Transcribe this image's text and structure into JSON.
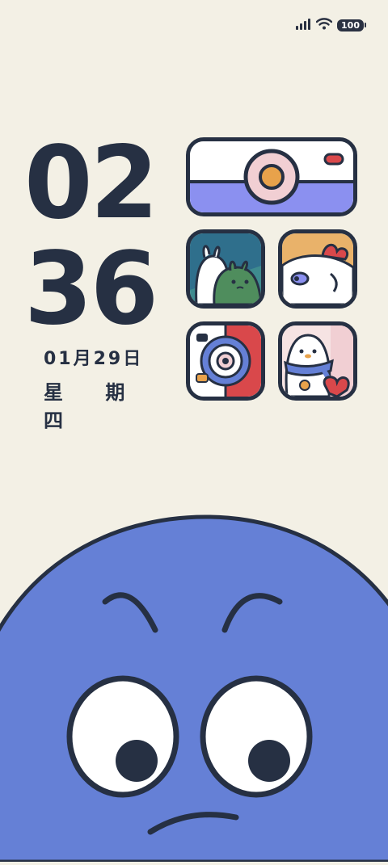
{
  "status_bar": {
    "battery": "100",
    "icons": [
      "signal-icon",
      "wifi-icon",
      "battery-icon"
    ]
  },
  "clock": {
    "hours": "02",
    "minutes": "36",
    "date": "01月29日",
    "weekday": "星 期 四"
  },
  "apps": [
    {
      "name": "camera-widget-icon"
    },
    {
      "name": "bunny-app-icon"
    },
    {
      "name": "chicken-app-icon"
    },
    {
      "name": "camera-app-icon"
    },
    {
      "name": "penguin-app-icon"
    }
  ],
  "colors": {
    "background": "#f3f0e5",
    "ink": "#263043",
    "mascot_blue": "#6580d6",
    "accent_purple": "#8b90f0",
    "accent_pink": "#f1cfd3",
    "accent_orange": "#e8a24b",
    "accent_red": "#d9484b"
  }
}
